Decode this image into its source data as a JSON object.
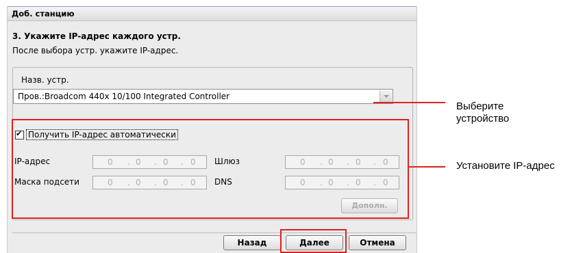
{
  "window": {
    "title": "Доб. станцию"
  },
  "step": {
    "title": "3. Укажите IP-адрес каждого устр.",
    "subtitle": "После выбора устр. укажите IP-адрес."
  },
  "device": {
    "label": "Назв. устр.",
    "selected": "Пров.:Broadcom 440x 10/100 Integrated Controller"
  },
  "ip": {
    "auto_label": "Получить IP-адрес автоматически",
    "auto_checked": true,
    "address_label": "IP-адрес",
    "gateway_label": "Шлюз",
    "mask_label": "Маска подсети",
    "dns_label": "DNS",
    "octets": [
      "0",
      "0",
      "0",
      "0"
    ],
    "dot": ".",
    "advanced_label": "Дополн."
  },
  "buttons": {
    "back": "Назад",
    "next": "Далее",
    "cancel": "Отмена"
  },
  "annotations": {
    "select_device_line1": "Выберите",
    "select_device_line2": "устройство",
    "set_ip": "Установите IP-адрес"
  },
  "colors": {
    "highlight": "#e02020",
    "dialog_bg": "#ececec"
  }
}
